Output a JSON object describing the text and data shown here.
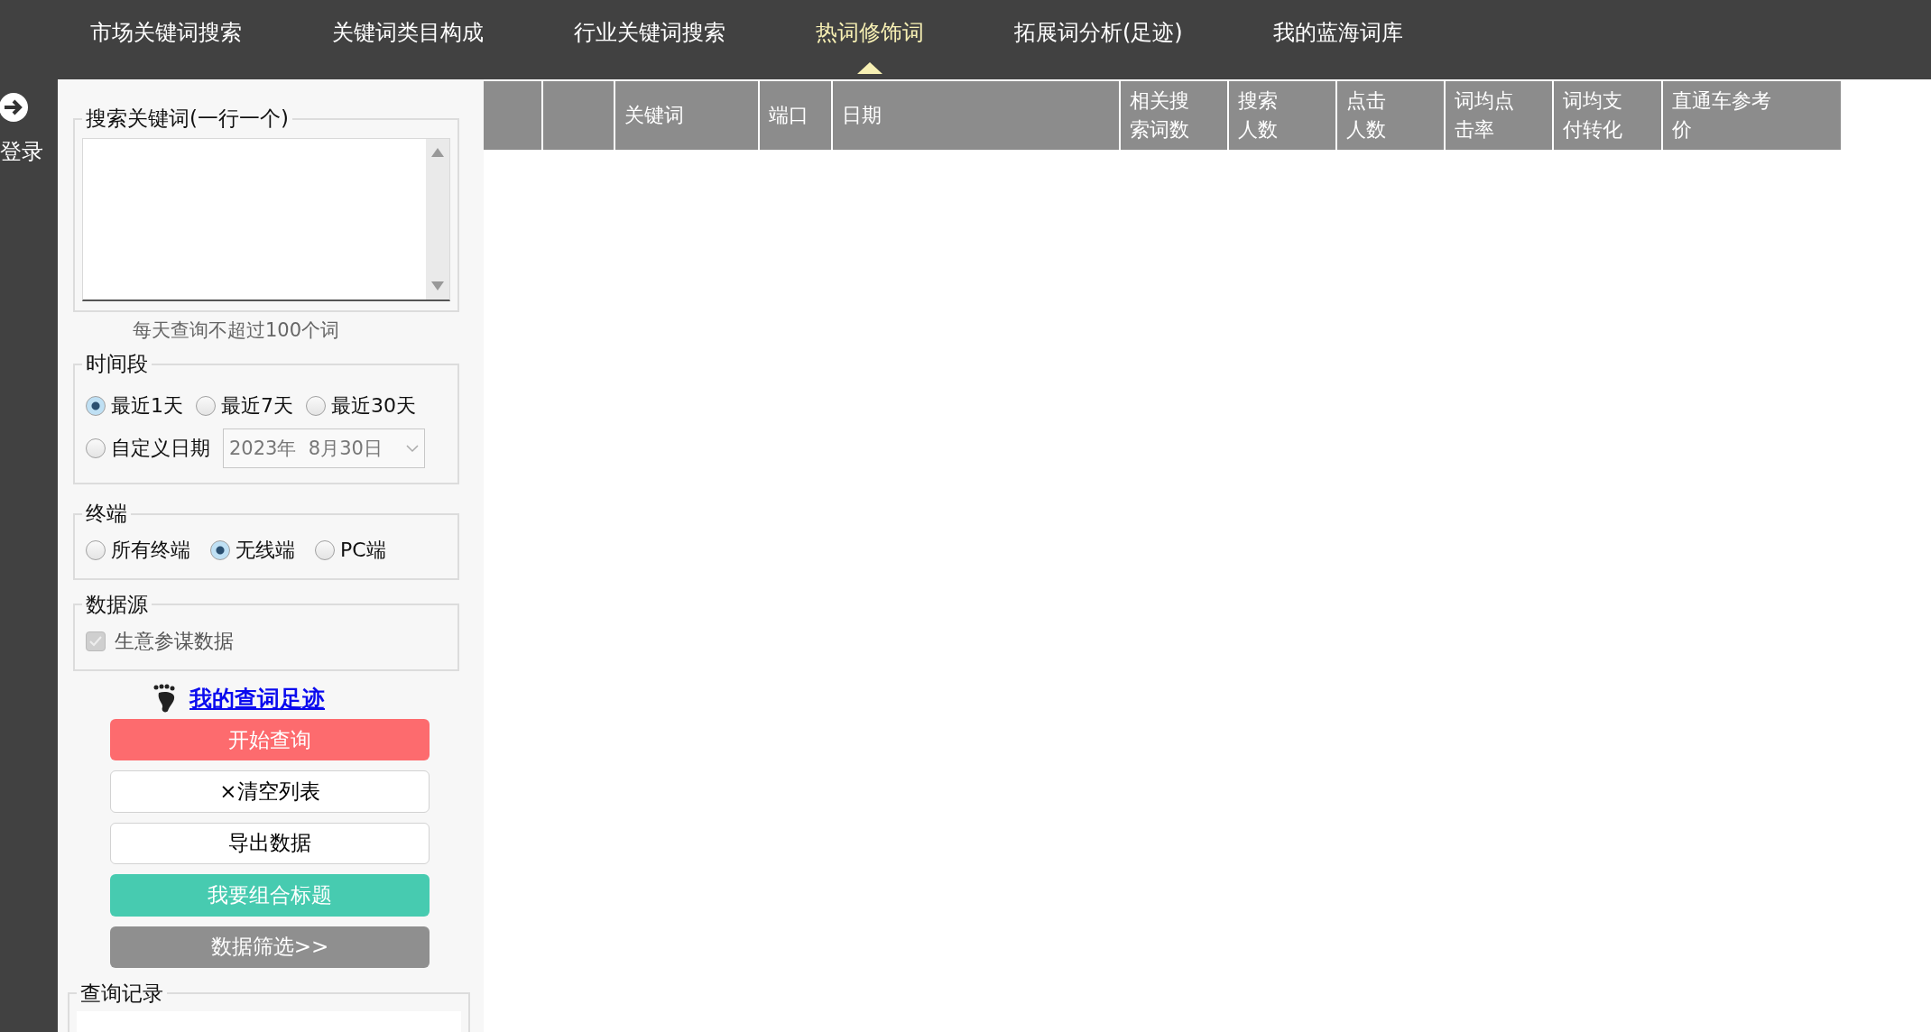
{
  "nav_tabs": [
    {
      "label": "市场关键词搜索",
      "selected": false
    },
    {
      "label": "关键词类目构成",
      "selected": false
    },
    {
      "label": "行业关键词搜索",
      "selected": false
    },
    {
      "label": "热词修饰词",
      "selected": true
    },
    {
      "label": "拓展词分析(足迹)",
      "selected": false
    },
    {
      "label": "我的蓝海词库",
      "selected": false
    }
  ],
  "side_strip": {
    "login_label": "登录"
  },
  "keyword_box": {
    "legend": "搜索关键词(一行一个)",
    "hint": "每天查询不超过100个词"
  },
  "time_range": {
    "legend": "时间段",
    "options": [
      {
        "label": "最近1天",
        "selected": true
      },
      {
        "label": "最近7天",
        "selected": false
      },
      {
        "label": "最近30天",
        "selected": false
      },
      {
        "label": "自定义日期",
        "selected": false
      }
    ],
    "date_value": "2023年  8月30日"
  },
  "terminal": {
    "legend": "终端",
    "options": [
      {
        "label": "所有终端",
        "selected": false
      },
      {
        "label": "无线端",
        "selected": true
      },
      {
        "label": "PC端",
        "selected": false
      }
    ]
  },
  "data_source": {
    "legend": "数据源",
    "label": "生意参谋数据",
    "checked": true,
    "disabled": true
  },
  "history_link": "我的查词足迹",
  "buttons": [
    {
      "label": "开始查询",
      "kind": "primary"
    },
    {
      "label": "×清空列表",
      "kind": "plain"
    },
    {
      "label": "导出数据",
      "kind": "plain"
    },
    {
      "label": "我要组合标题",
      "kind": "accent"
    },
    {
      "label": "数据筛选>>",
      "kind": "muted"
    }
  ],
  "history": {
    "legend": "查询记录"
  },
  "table": {
    "columns": [
      {},
      {},
      {
        "label": "关键词"
      },
      {
        "label": "端口"
      },
      {
        "label": "日期"
      },
      {
        "label": "相关搜索词数"
      },
      {
        "label": "搜索人数"
      },
      {
        "label": "点击人数"
      },
      {
        "label": "词均点击率"
      },
      {
        "label": "词均支付转化"
      },
      {
        "label": "直通车参考价"
      }
    ]
  }
}
